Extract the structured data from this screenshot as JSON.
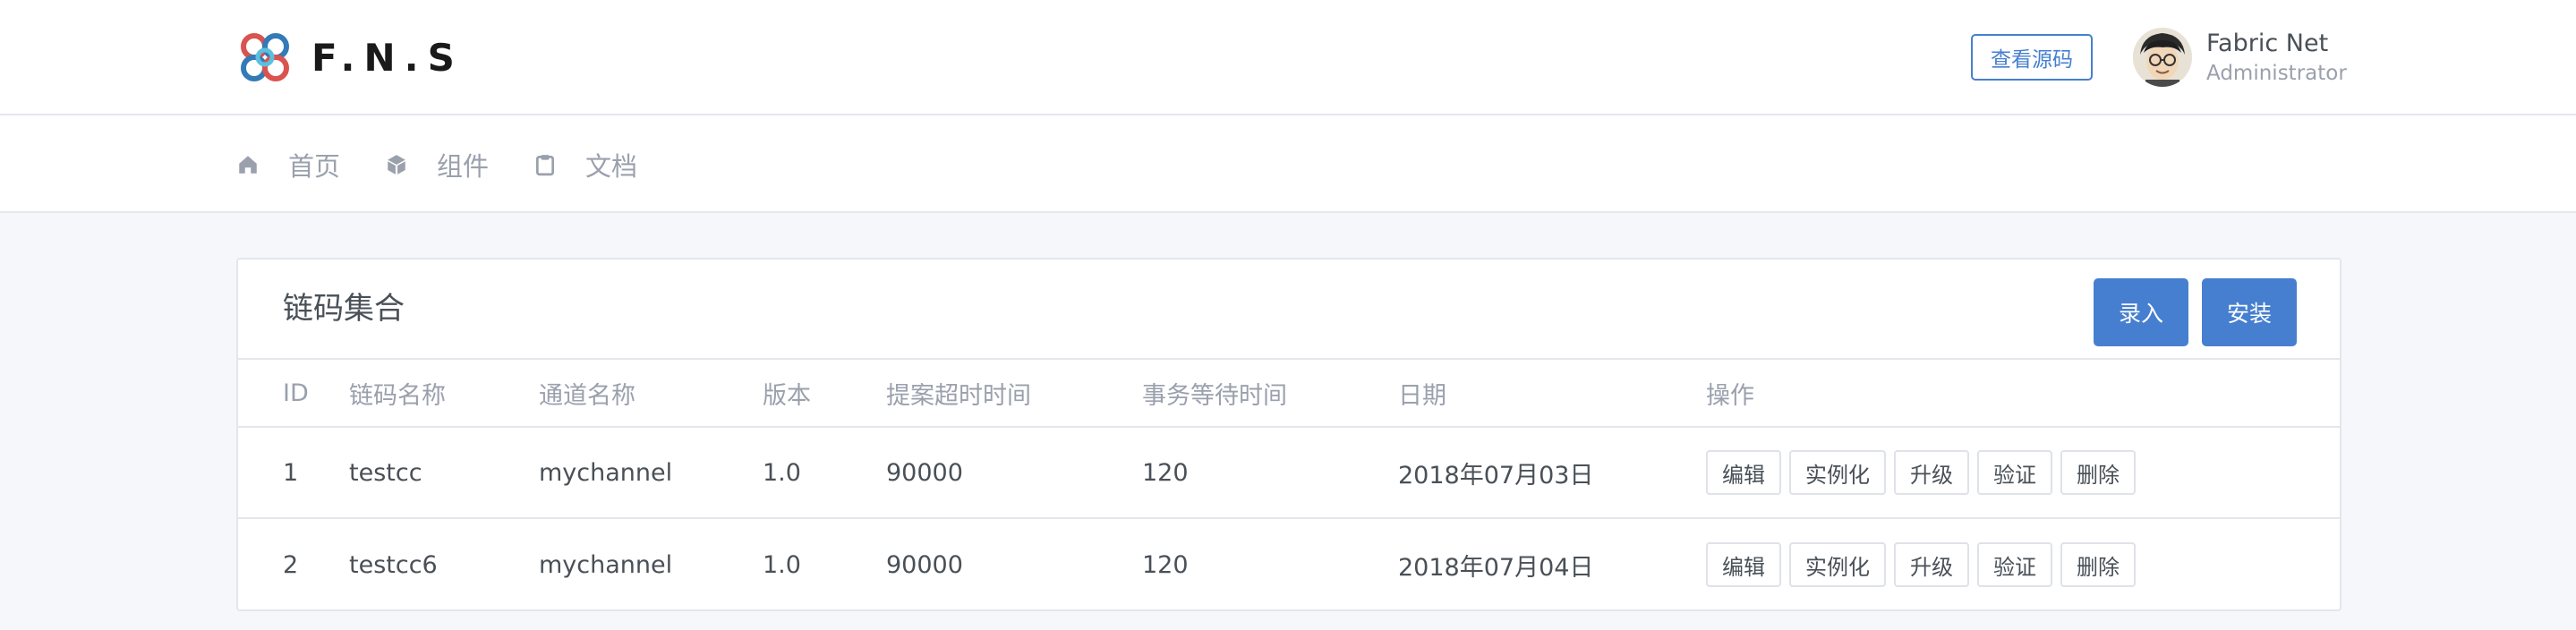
{
  "header": {
    "brand": "F.N.S",
    "source_button": "查看源码",
    "user": {
      "name": "Fabric Net",
      "role": "Administrator"
    }
  },
  "nav": {
    "items": [
      {
        "label": "首页",
        "icon": "home-icon"
      },
      {
        "label": "组件",
        "icon": "box-icon"
      },
      {
        "label": "文档",
        "icon": "clipboard-icon"
      }
    ]
  },
  "card": {
    "title": "链码集合",
    "enter_button": "录入",
    "install_button": "安装"
  },
  "table": {
    "headers": [
      "ID",
      "链码名称",
      "通道名称",
      "版本",
      "提案超时时间",
      "事务等待时间",
      "日期",
      "操作"
    ],
    "rows": [
      {
        "id": "1",
        "name": "testcc",
        "channel": "mychannel",
        "version": "1.0",
        "proposal_timeout": "90000",
        "tx_wait": "120",
        "date": "2018年07月03日"
      },
      {
        "id": "2",
        "name": "testcc6",
        "channel": "mychannel",
        "version": "1.0",
        "proposal_timeout": "90000",
        "tx_wait": "120",
        "date": "2018年07月04日"
      }
    ],
    "actions": [
      "编辑",
      "实例化",
      "升级",
      "验证",
      "删除"
    ]
  },
  "colors": {
    "primary": "#467fcf",
    "background": "#f5f7fb",
    "muted": "#9aa0ac"
  }
}
